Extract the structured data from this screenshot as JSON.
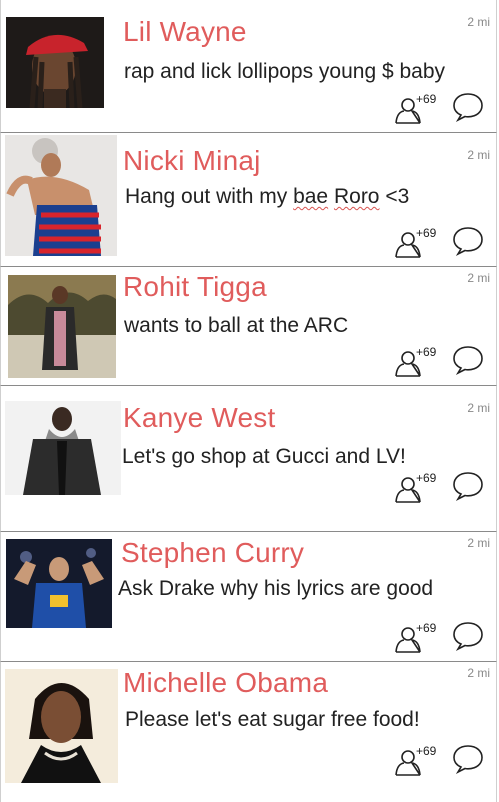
{
  "accent_color": "#e05c5c",
  "feed": [
    {
      "name": "Lil Wayne",
      "status": "rap and lick lollipops young $ baby",
      "distance": "2 mi",
      "join_count": "+69",
      "photo_icon": "lil-wayne-photo"
    },
    {
      "name": "Nicki Minaj",
      "status_parts": [
        "Hang out with my ",
        "bae",
        " ",
        "Roro",
        " <3"
      ],
      "distance": "2 mi",
      "join_count": "+69",
      "photo_icon": "nicki-minaj-photo"
    },
    {
      "name": "Rohit Tigga",
      "status": "wants to ball at the ARC",
      "distance": "2 mi",
      "join_count": "+69",
      "photo_icon": "rohit-tigga-photo"
    },
    {
      "name": "Kanye West",
      "status": "Let's go shop at Gucci and LV!",
      "distance": "2 mi",
      "join_count": "+69",
      "photo_icon": "kanye-west-photo"
    },
    {
      "name": "Stephen Curry",
      "status": "Ask Drake why his lyrics are good",
      "distance": "2 mi",
      "join_count": "+69",
      "photo_icon": "stephen-curry-photo"
    },
    {
      "name": "Michelle Obama",
      "status": "Please let's eat sugar free food!",
      "distance": "2 mi",
      "join_count": "+69",
      "photo_icon": "michelle-obama-photo"
    }
  ]
}
